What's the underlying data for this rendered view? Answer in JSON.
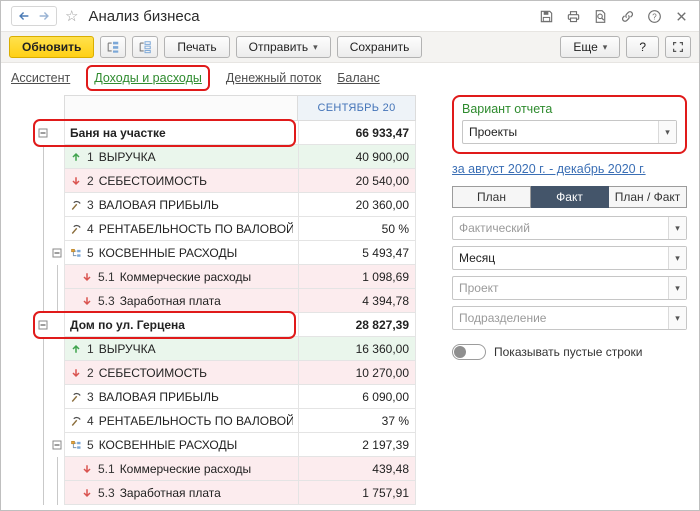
{
  "colors": {
    "annotation_red": "#e01a1a",
    "accent_yellow": "#ffd015",
    "active_tab_green": "#2e8b2e",
    "variant_label_green": "#2e8b2e",
    "table_header_blue": "#4474b8",
    "link_blue": "#3b6fb5",
    "revenue_row_bg": "#eaf6ec",
    "expense_row_bg": "#fcecee",
    "segment_active_bg": "#44556a"
  },
  "icons": {
    "caret_down": "▾",
    "star": "☆"
  },
  "titlebar": {
    "title": "Анализ бизнеса"
  },
  "toolbar": {
    "refresh_label": "Обновить",
    "print_label": "Печать",
    "send_label": "Отправить",
    "save_label": "Сохранить",
    "more_label": "Еще",
    "help_label": "?"
  },
  "tabs": [
    {
      "label": "Ассистент",
      "active": false,
      "annotated": false
    },
    {
      "label": "Доходы и расходы",
      "active": true,
      "annotated": true
    },
    {
      "label": "Денежный поток",
      "active": false,
      "annotated": false
    },
    {
      "label": "Баланс",
      "active": false,
      "annotated": false
    }
  ],
  "table": {
    "period_header": "СЕНТЯБРЬ 20",
    "groups": [
      {
        "name": "Баня на участке",
        "total": "66 933,47",
        "annotated": true,
        "rows": [
          {
            "icon": "arrow-up",
            "num": "1",
            "label": "ВЫРУЧКА",
            "value": "40 900,00",
            "tint": "green"
          },
          {
            "icon": "arrow-down",
            "num": "2",
            "label": "СЕБЕСТОИМОСТЬ",
            "value": "20 540,00",
            "tint": "pink"
          },
          {
            "icon": "formula",
            "num": "3",
            "label": "ВАЛОВАЯ ПРИБЫЛЬ",
            "value": "20 360,00",
            "tint": "none"
          },
          {
            "icon": "formula",
            "num": "4",
            "label": "РЕНТАБЕЛЬНОСТЬ ПО ВАЛОВОЙ ПРИБЫ",
            "value": "50 %",
            "tint": "none"
          },
          {
            "icon": "structure",
            "num": "5",
            "label": "КОСВЕННЫЕ РАСХОДЫ",
            "value": "5 493,47",
            "tint": "none",
            "expandable": true
          },
          {
            "icon": "arrow-down",
            "num": "5.1",
            "label": "Коммерческие расходы",
            "value": "1 098,69",
            "tint": "pink",
            "sub": true
          },
          {
            "icon": "arrow-down",
            "num": "5.3",
            "label": "Заработная плата",
            "value": "4 394,78",
            "tint": "pink",
            "sub": true
          }
        ]
      },
      {
        "name": "Дом по ул. Герцена",
        "total": "28 827,39",
        "annotated": true,
        "rows": [
          {
            "icon": "arrow-up",
            "num": "1",
            "label": "ВЫРУЧКА",
            "value": "16 360,00",
            "tint": "green"
          },
          {
            "icon": "arrow-down",
            "num": "2",
            "label": "СЕБЕСТОИМОСТЬ",
            "value": "10 270,00",
            "tint": "pink"
          },
          {
            "icon": "formula",
            "num": "3",
            "label": "ВАЛОВАЯ ПРИБЫЛЬ",
            "value": "6 090,00",
            "tint": "none"
          },
          {
            "icon": "formula",
            "num": "4",
            "label": "РЕНТАБЕЛЬНОСТЬ ПО ВАЛОВОЙ ПРИБЫ",
            "value": "37 %",
            "tint": "none"
          },
          {
            "icon": "structure",
            "num": "5",
            "label": "КОСВЕННЫЕ РАСХОДЫ",
            "value": "2 197,39",
            "tint": "none",
            "expandable": true
          },
          {
            "icon": "arrow-down",
            "num": "5.1",
            "label": "Коммерческие расходы",
            "value": "439,48",
            "tint": "pink",
            "sub": true
          },
          {
            "icon": "arrow-down",
            "num": "5.3",
            "label": "Заработная плата",
            "value": "1 757,91",
            "tint": "pink",
            "sub": true
          }
        ]
      }
    ]
  },
  "panel": {
    "variant_label": "Вариант отчета",
    "variant_value": "Проекты",
    "period_link": "за август 2020 г. - декабрь 2020 г.",
    "modes": [
      {
        "label": "План",
        "active": false
      },
      {
        "label": "Факт",
        "active": true
      },
      {
        "label": "План / Факт",
        "active": false
      }
    ],
    "filters": [
      {
        "text": "Фактический",
        "muted": true
      },
      {
        "text": "Месяц",
        "muted": false
      },
      {
        "text": "Проект",
        "muted": true
      },
      {
        "text": "Подразделение",
        "muted": true
      }
    ],
    "empty_rows_toggle_label": "Показывать пустые строки",
    "empty_rows_toggle_on": false
  }
}
